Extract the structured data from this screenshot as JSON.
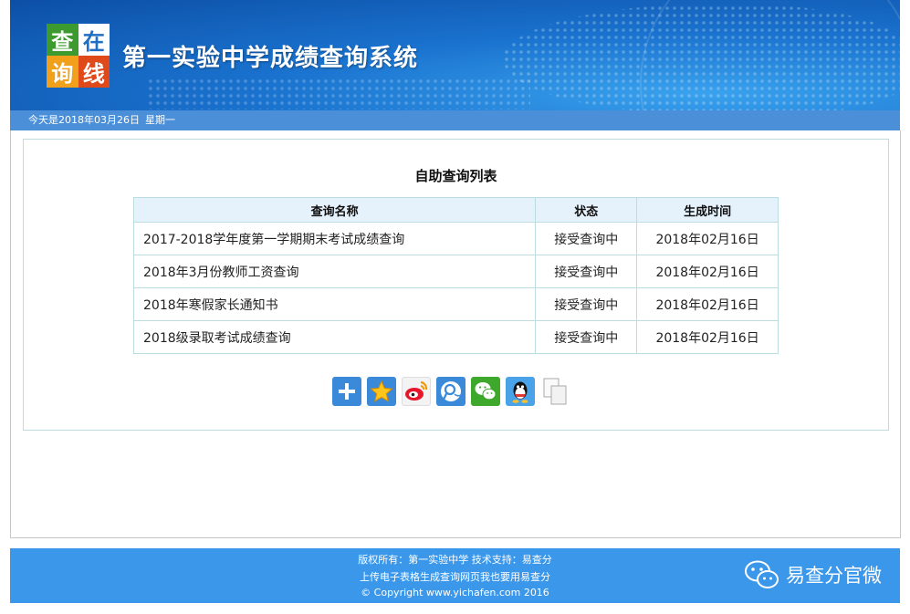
{
  "header": {
    "logo_chars": [
      "查",
      "在",
      "询",
      "线"
    ],
    "title": "第一实验中学成绩查询系统"
  },
  "datebar": {
    "date": "今天是2018年03月26日",
    "weekday": "星期一"
  },
  "main": {
    "list_title": "自助查询列表",
    "columns": [
      "查询名称",
      "状态",
      "生成时间"
    ],
    "rows": [
      {
        "name": "2017-2018学年度第一学期期末考试成绩查询",
        "status": "接受查询中",
        "time": "2018年02月16日"
      },
      {
        "name": "2018年3月份教师工资查询",
        "status": "接受查询中",
        "time": "2018年02月16日"
      },
      {
        "name": "2018年寒假家长通知书",
        "status": "接受查询中",
        "time": "2018年02月16日"
      },
      {
        "name": "2018级录取考试成绩查询",
        "status": "接受查询中",
        "time": "2018年02月16日"
      }
    ],
    "share_icons": [
      "plus-icon",
      "favorite-star-icon",
      "weibo-icon",
      "tencent-weibo-icon",
      "wechat-icon",
      "qq-icon",
      "copy-icon"
    ]
  },
  "footer": {
    "line1": "版权所有：第一实验中学  技术支持：易查分",
    "line2": "上传电子表格生成查询网页我也要用易查分",
    "line3": "© Copyright www.yichafen.com 2016",
    "brand": "易查分官微"
  },
  "colors": {
    "banner": "#1a73cf",
    "datebar": "#4a8fd8",
    "footer": "#3b97ea",
    "table_header": "#e5f1fb",
    "border": "#bcdde0"
  }
}
